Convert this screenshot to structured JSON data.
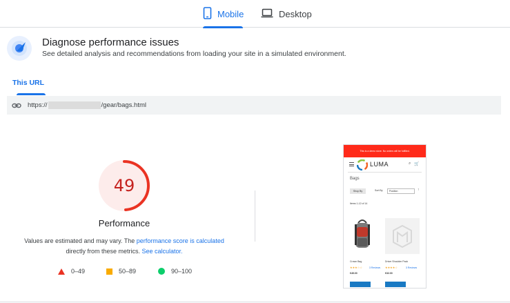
{
  "device_tabs": {
    "mobile_label": "Mobile",
    "desktop_label": "Desktop",
    "selected": "Mobile"
  },
  "diagnose": {
    "title": "Diagnose performance issues",
    "subtitle": "See detailed analysis and recommendations from loading your site in a simulated environment."
  },
  "url_section": {
    "tab_label": "This URL",
    "url_prefix": "https://",
    "url_suffix": "/gear/bags.html"
  },
  "score": {
    "value": "49",
    "fraction": 0.49,
    "label": "Performance",
    "note_prefix": "Values are estimated and may vary. The ",
    "note_link": "performance score is calculated",
    "note_middle": " directly from these metrics. ",
    "note_calc_link": "See calculator.",
    "status_color": "#c5221f"
  },
  "legend": [
    {
      "range": "0–49",
      "shape": "triangle",
      "color": "#ea3323"
    },
    {
      "range": "50–89",
      "shape": "square",
      "color": "#f9ab00"
    },
    {
      "range": "90–100",
      "shape": "circle",
      "color": "#0cce6b"
    }
  ],
  "thumbnail": {
    "demo_banner": "This is a demo store. No orders will be fulfilled.",
    "brand": "LUMA",
    "page_title": "Bags",
    "shop_by": "Shop By",
    "sort_by": "Sort By",
    "sort_value": "Position",
    "items_count": "Items 1-12 of 14",
    "products": [
      {
        "name": "Crown Bag",
        "reviews": "3  Reviews",
        "price": "€45.00",
        "stars": "★★★☆☆"
      },
      {
        "name": "Driver Shoulder Pack",
        "reviews": "3  Reviews",
        "price": "€32.00",
        "stars": "★★★★☆"
      }
    ]
  }
}
